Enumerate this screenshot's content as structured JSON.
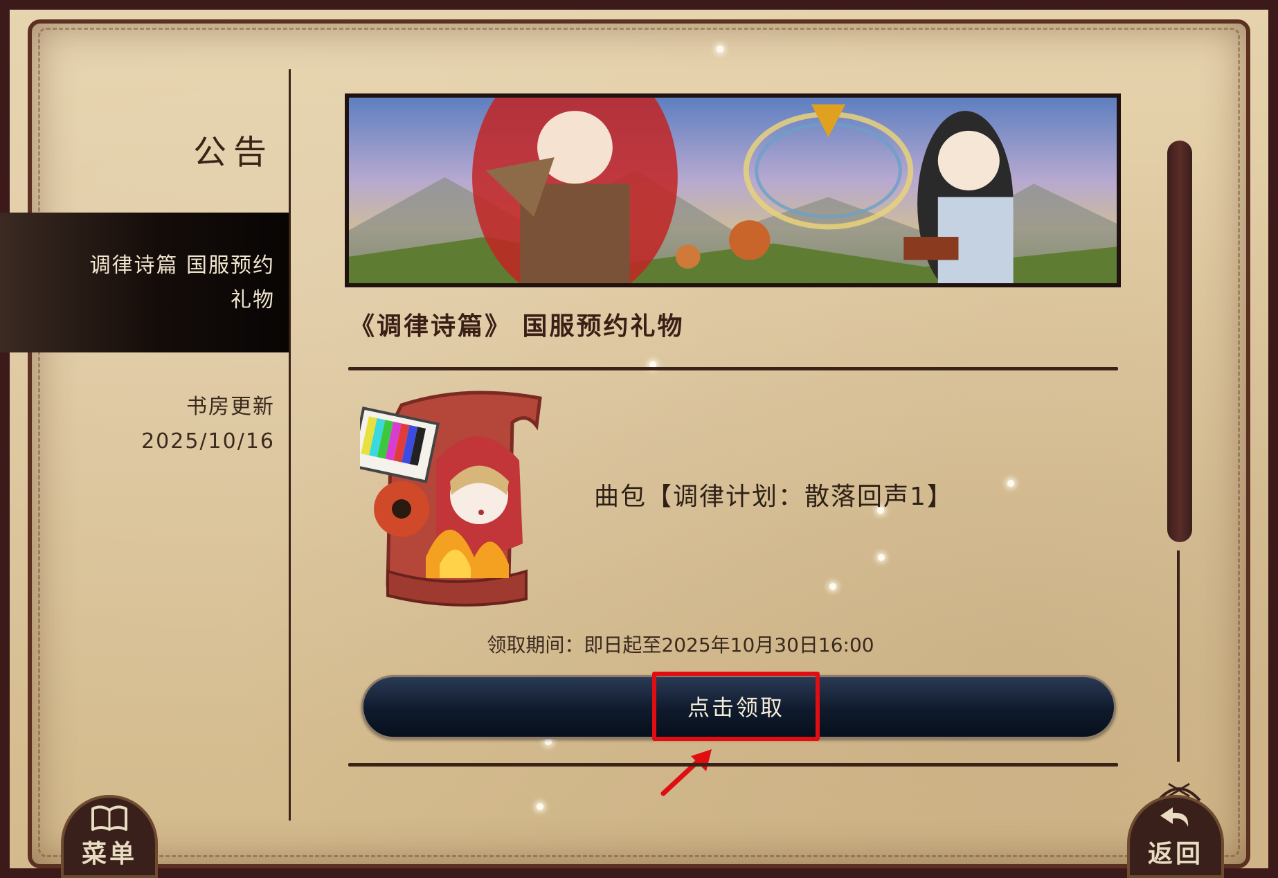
{
  "sidebar": {
    "title": "公告",
    "items": [
      {
        "label_line1": "调律诗篇 国服预约",
        "label_line2": "礼物",
        "active": true
      },
      {
        "label_line1": "书房更新",
        "label_line2": "2025/10/16",
        "active": false
      }
    ]
  },
  "announcement": {
    "title": "《调律诗篇》 国服预约礼物",
    "reward_name": "曲包【调律计划：散落回声1】",
    "claim_period": "领取期间：即日起至2025年10月30日16:00",
    "claim_button_label": "点击领取"
  },
  "bottom_nav": {
    "menu_label": "菜单",
    "back_label": "返回"
  },
  "icons": {
    "menu": "open-book-icon",
    "back": "return-arrow-icon",
    "reward": "scroll-character-icon"
  },
  "colors": {
    "accent_highlight": "#e00d12",
    "button_bg": "#0f1a2c",
    "frame": "#3d1a1a",
    "parchment": "#dcc59c"
  }
}
